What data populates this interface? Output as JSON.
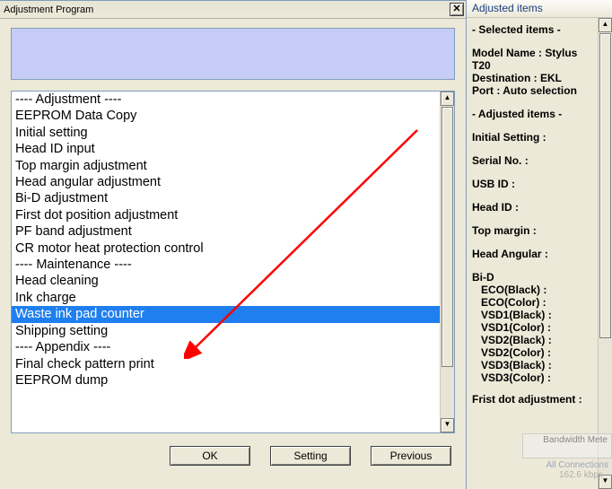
{
  "window": {
    "title": "Adjustment Program",
    "close_glyph": "✕"
  },
  "list": [
    {
      "text": "---- Adjustment ----",
      "kind": "header"
    },
    {
      "text": "EEPROM Data Copy",
      "kind": "item"
    },
    {
      "text": "Initial setting",
      "kind": "item"
    },
    {
      "text": "Head ID input",
      "kind": "item"
    },
    {
      "text": "Top margin adjustment",
      "kind": "item"
    },
    {
      "text": "Head angular adjustment",
      "kind": "item"
    },
    {
      "text": "Bi-D adjustment",
      "kind": "item"
    },
    {
      "text": "First dot position adjustment",
      "kind": "item"
    },
    {
      "text": "PF band adjustment",
      "kind": "item"
    },
    {
      "text": "CR motor heat protection control",
      "kind": "item"
    },
    {
      "text": " ",
      "kind": "spacer"
    },
    {
      "text": "---- Maintenance ----",
      "kind": "header"
    },
    {
      "text": "Head cleaning",
      "kind": "item"
    },
    {
      "text": "Ink charge",
      "kind": "item"
    },
    {
      "text": "Waste ink pad counter",
      "kind": "item",
      "selected": true
    },
    {
      "text": "Shipping setting",
      "kind": "item"
    },
    {
      "text": " ",
      "kind": "spacer"
    },
    {
      "text": "---- Appendix ----",
      "kind": "header"
    },
    {
      "text": "Final check pattern print",
      "kind": "item"
    },
    {
      "text": "EEPROM dump",
      "kind": "item"
    }
  ],
  "buttons": {
    "ok": "OK",
    "setting": "Setting",
    "previous": "Previous"
  },
  "sidebar": {
    "title": "Adjusted items",
    "selected_heading": "- Selected items -",
    "model_label": "Model Name : Stylus T20",
    "dest_label": "Destination : EKL",
    "port_label": "Port : Auto selection",
    "adjusted_heading": "- Adjusted items -",
    "rows": [
      "Initial Setting :",
      "Serial No. :",
      "USB ID :",
      "Head ID :",
      "Top margin :",
      "Head Angular :"
    ],
    "bid_label": "Bi-D",
    "bid_rows": [
      "ECO(Black)  :",
      "ECO(Color)  :",
      "VSD1(Black) :",
      "VSD1(Color) :",
      "VSD2(Black) :",
      "VSD2(Color) :",
      "VSD3(Black) :",
      "VSD3(Color) :"
    ],
    "first_dot_label": "Frist dot adjustment :"
  },
  "ghost": {
    "line1": "Bandwidth Mete",
    "line2": "All Connections",
    "line3": "162.6 kbps ·"
  }
}
